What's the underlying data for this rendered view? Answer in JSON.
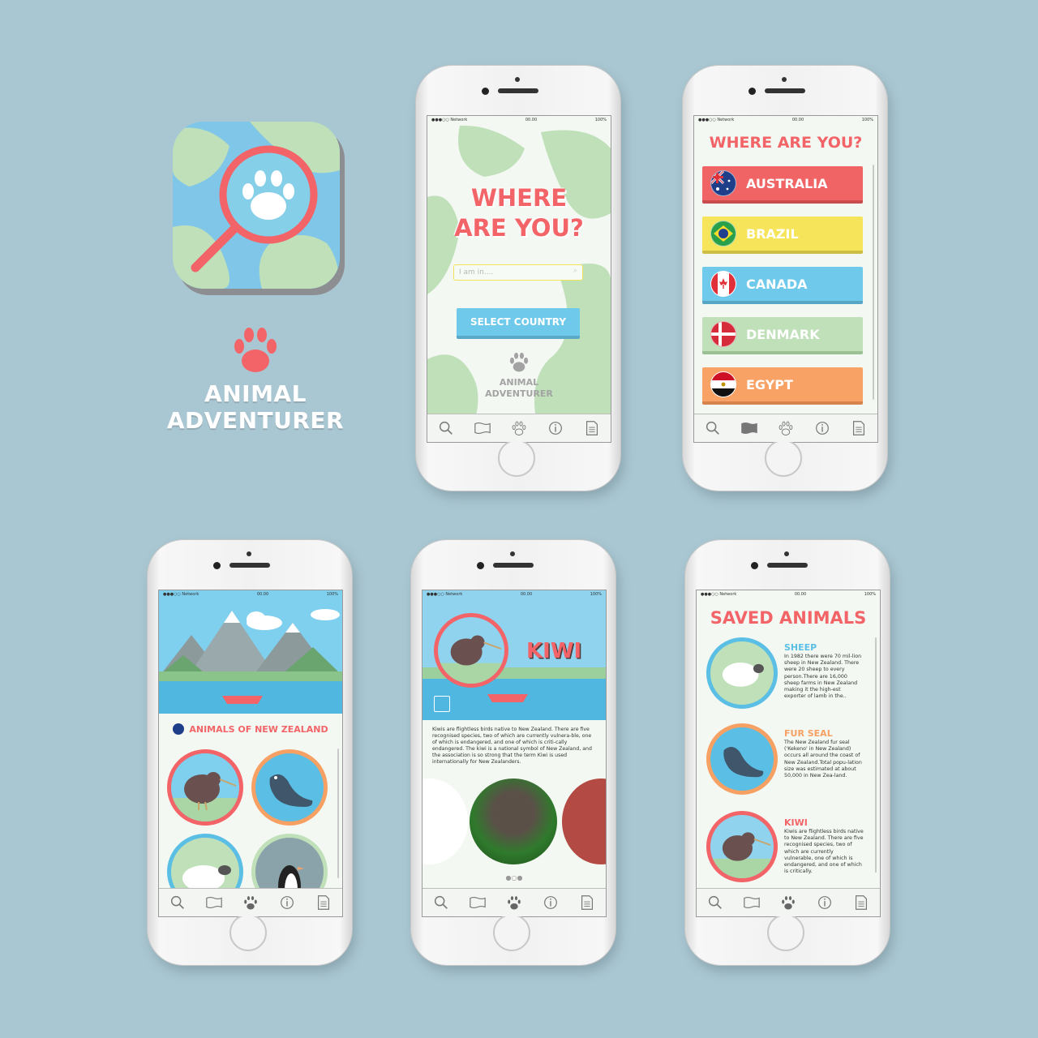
{
  "brand": {
    "name_line1": "ANIMAL",
    "name_line2": "ADVENTURER",
    "app_icon": "magnifier-paw-map-icon",
    "accent": "#f26467"
  },
  "status_bar": {
    "carrier": "●●●○○ Network",
    "time": "00.00",
    "battery": "100%"
  },
  "tabs": [
    "search-icon",
    "map-icon",
    "paw-icon",
    "info-icon",
    "notes-icon"
  ],
  "screen1": {
    "title_line1": "WHERE",
    "title_line2": "ARE YOU?",
    "search_placeholder": "I am in....",
    "select_button": "SELECT COUNTRY",
    "brand_line1": "ANIMAL",
    "brand_line2": "ADVENTURER"
  },
  "screen2": {
    "title": "WHERE ARE YOU?",
    "countries": [
      {
        "name": "AUSTRALIA",
        "color": "#f06465",
        "shade": "#c94c4f"
      },
      {
        "name": "BRAZIL",
        "color": "#f6e55b",
        "shade": "#cfbe45"
      },
      {
        "name": "CANADA",
        "color": "#6ec9ea",
        "shade": "#56a7c6"
      },
      {
        "name": "DENMARK",
        "color": "#bfe0b9",
        "shade": "#9bc094"
      },
      {
        "name": "EGYPT",
        "color": "#f8a266",
        "shade": "#d6834e"
      }
    ]
  },
  "screen3": {
    "heading": "ANIMALS OF NEW ZEALAND",
    "animals": [
      "kiwi",
      "fur seal",
      "sheep",
      "penguin"
    ]
  },
  "screen4": {
    "title": "KIWI",
    "description": "Kiwis are flightless birds native to New Zealand. There are five recognised species, two of which are currently vulnera-ble, one of which is endangered, and one of which is criti-cally endangered. The kiwi is a national symbol of New Zealand, and the association is so strong that the term Kiwi is used internationally for New Zealanders.",
    "gallery_pages": 3,
    "gallery_active": 1
  },
  "screen5": {
    "title": "SAVED ANIMALS",
    "items": [
      {
        "name": "SHEEP",
        "color": "#5bbfe5",
        "text": "In 1982 there were 70 mil-lion sheep in New Zealand. There were 20 sheep to every person.There are 16,000 sheep farms in New Zealand making it the high-est exporter of lamb in the.."
      },
      {
        "name": "FUR SEAL",
        "color": "#f6a163",
        "text": "The New Zealand fur seal ('Kekeno' in New Zealand) occurs all around the coast of New Zealand.Total popu-lation size was estimated at about 50,000 in New Zea-land."
      },
      {
        "name": "KIWI",
        "color": "#f26467",
        "text": "Kiwis are flightless birds native to New Zealand. There are five recognised species, two of which are currently vulnerable, one of which is endangered, and one of which is critically."
      }
    ]
  }
}
